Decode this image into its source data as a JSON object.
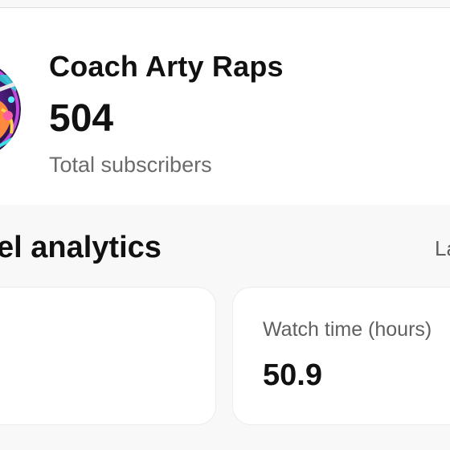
{
  "channel": {
    "name": "Coach Arty Raps",
    "subscriber_count": "504",
    "subscriber_label": "Total subscribers",
    "avatar_icon": "channel-avatar-illustration"
  },
  "analytics": {
    "title_visible": "el analytics",
    "link_visible": "La",
    "cards": [
      {
        "label": "",
        "value": ""
      },
      {
        "label": "Watch time (hours)",
        "value": "50.9"
      }
    ]
  },
  "colors": {
    "page_bg": "#f8f8f9",
    "card_bg": "#ffffff",
    "primary_text": "#111111",
    "secondary_text": "#6b6b6b"
  }
}
